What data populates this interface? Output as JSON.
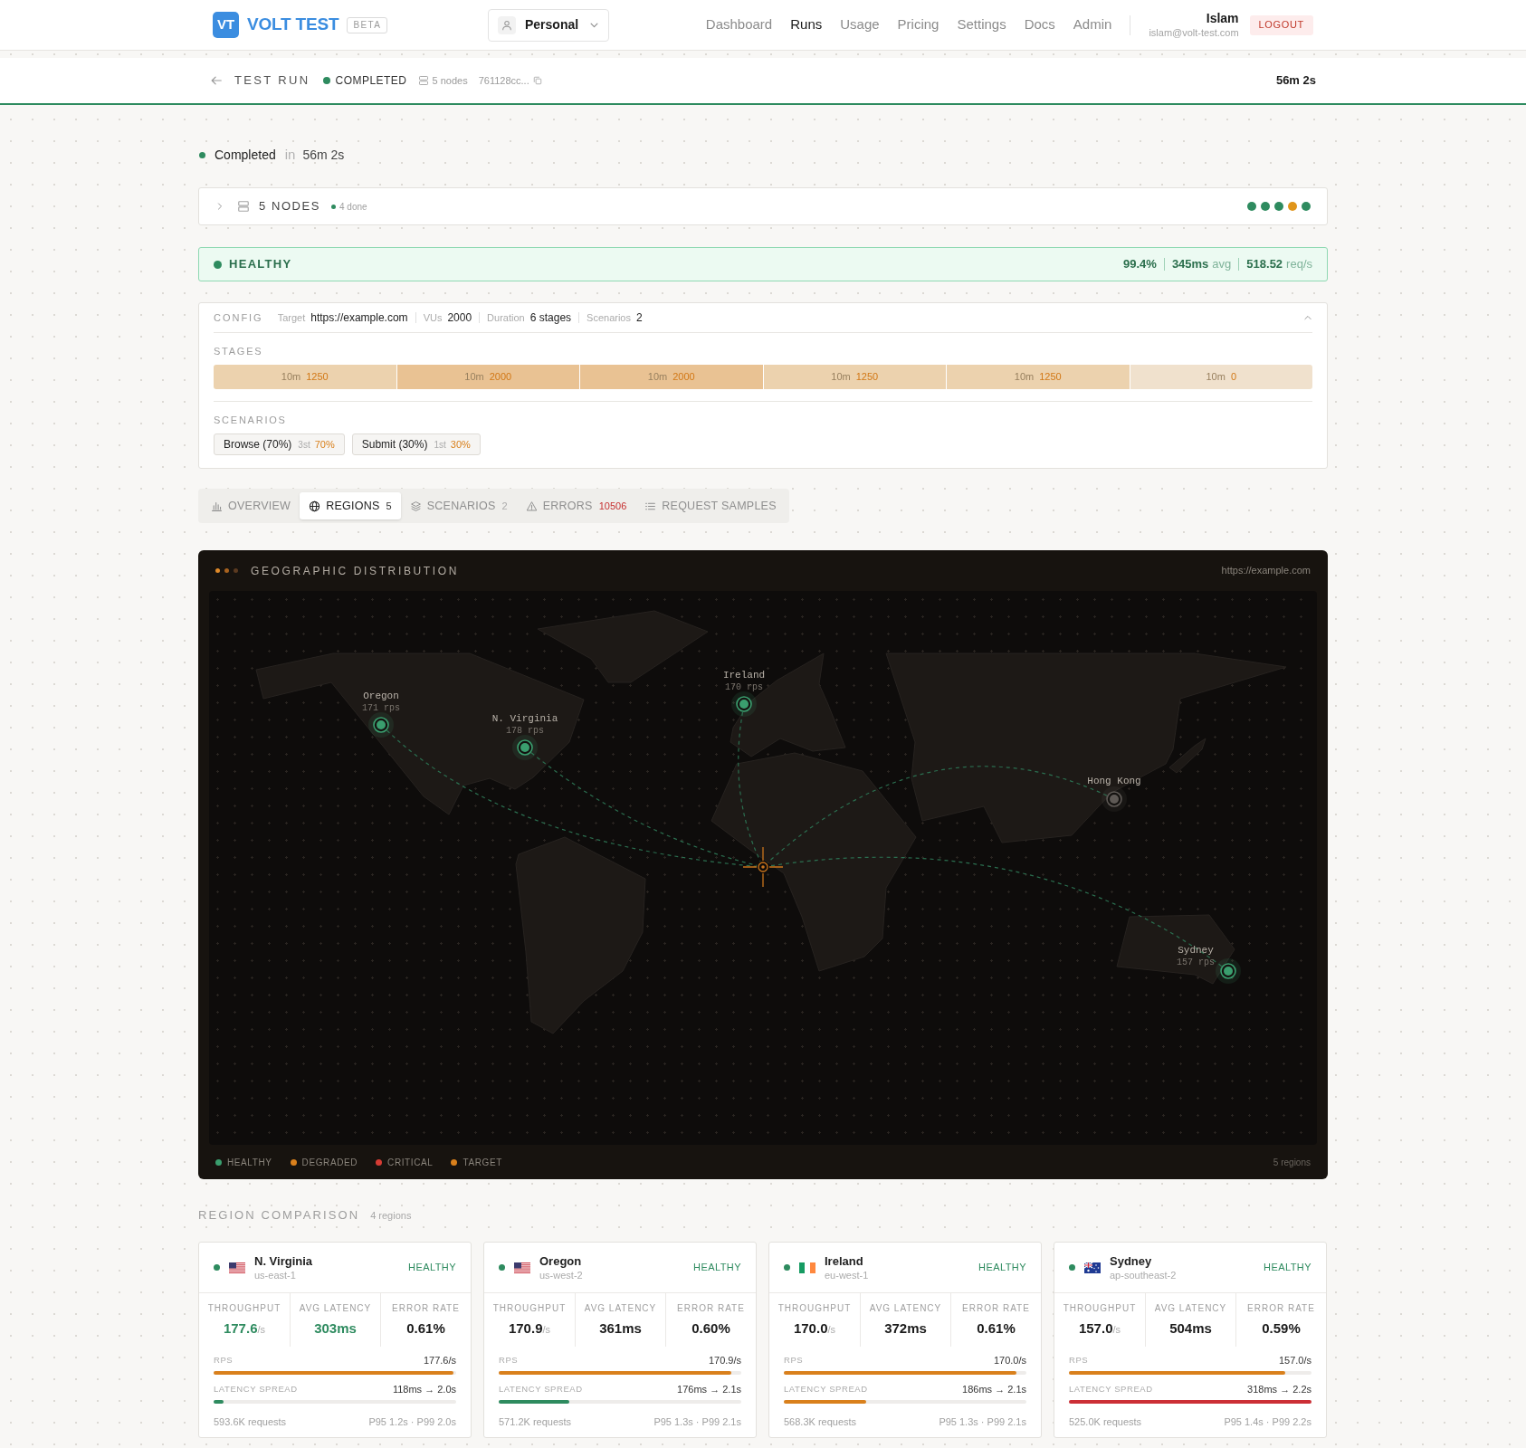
{
  "header": {
    "logo_mark": "VT",
    "brand": "VOLT TEST",
    "badge": "BETA",
    "workspace": "Personal",
    "nav": [
      {
        "label": "Dashboard",
        "selected": false
      },
      {
        "label": "Runs",
        "selected": true
      },
      {
        "label": "Usage",
        "selected": false
      },
      {
        "label": "Pricing",
        "selected": false
      },
      {
        "label": "Settings",
        "selected": false
      },
      {
        "label": "Docs",
        "selected": false
      },
      {
        "label": "Admin",
        "selected": false
      }
    ],
    "user": {
      "name": "Islam",
      "email": "islam@volt-test.com"
    },
    "logout": "LOGOUT"
  },
  "run_bar": {
    "title": "TEST RUN",
    "status": "COMPLETED",
    "nodes": "5 nodes",
    "run_id": "761128cc...",
    "duration": "56m 2s"
  },
  "summary": {
    "status": "Completed",
    "connector": "in",
    "duration": "56m 2s"
  },
  "nodes_panel": {
    "label": "5 NODES",
    "done": "4 done",
    "expanded": false,
    "nodes": [
      {
        "color": "#2e8b5f"
      },
      {
        "color": "#2e8b5f"
      },
      {
        "color": "#2e8b5f"
      },
      {
        "color": "#e0951a"
      },
      {
        "color": "#2e8b5f"
      }
    ]
  },
  "health": {
    "status": "HEALTHY",
    "success_rate": "99.4%",
    "latency": "345ms",
    "latency_unit": "avg",
    "throughput": "518.52",
    "throughput_unit": "req/s"
  },
  "config": {
    "heading": "CONFIG",
    "expanded": true,
    "fields": [
      {
        "label": "Target",
        "value": "https://example.com"
      },
      {
        "label": "VUs",
        "value": "2000"
      },
      {
        "label": "Duration",
        "value": "6 stages"
      },
      {
        "label": "Scenarios",
        "value": "2"
      }
    ],
    "stages_heading": "STAGES",
    "stages": [
      {
        "duration": "10m",
        "target": "1250",
        "color": "#ecd2ae"
      },
      {
        "duration": "10m",
        "target": "2000",
        "color": "#e9c293"
      },
      {
        "duration": "10m",
        "target": "2000",
        "color": "#e9c293"
      },
      {
        "duration": "10m",
        "target": "1250",
        "color": "#ecd2ae"
      },
      {
        "duration": "10m",
        "target": "1250",
        "color": "#ecd2ae"
      },
      {
        "duration": "10m",
        "target": "0",
        "color": "#f0e1cd"
      }
    ],
    "scenarios_heading": "SCENARIOS",
    "scenarios": [
      {
        "name": "Browse (70%)",
        "order": "3st",
        "weight": "70%"
      },
      {
        "name": "Submit (30%)",
        "order": "1st",
        "weight": "30%"
      }
    ]
  },
  "tabs": [
    {
      "kind": "overview",
      "label": "OVERVIEW",
      "selected": false
    },
    {
      "kind": "regions",
      "label": "REGIONS",
      "count": "5",
      "selected": true
    },
    {
      "kind": "scenarios",
      "label": "SCENARIOS",
      "count": "2",
      "selected": false
    },
    {
      "kind": "errors",
      "label": "ERRORS",
      "count": "10506",
      "selected": false
    },
    {
      "kind": "samples",
      "label": "REQUEST SAMPLES",
      "selected": false
    }
  ],
  "map": {
    "title": "GEOGRAPHIC DISTRIBUTION",
    "target": "https://example.com",
    "regions": [
      {
        "name": "Oregon",
        "rps": "171 rps",
        "active": true
      },
      {
        "name": "N. Virginia",
        "rps": "178 rps",
        "active": true
      },
      {
        "name": "Ireland",
        "rps": "170 rps",
        "active": true
      },
      {
        "name": "Hong Kong",
        "active": false
      },
      {
        "name": "Sydney",
        "rps": "157 rps",
        "active": true
      }
    ],
    "legend": [
      {
        "label": "HEALTHY",
        "color": "#3a9e6e"
      },
      {
        "label": "DEGRADED",
        "color": "#d9801c"
      },
      {
        "label": "CRITICAL",
        "color": "#d63c34"
      },
      {
        "label": "TARGET",
        "color": "#d9801c"
      }
    ],
    "region_count": "5 regions"
  },
  "region_comparison": {
    "title": "REGION COMPARISON",
    "count": "4 regions",
    "cards": [
      {
        "kind": "us",
        "name": "N. Virginia",
        "code": "us-east-1",
        "status": "HEALTHY",
        "metrics": [
          {
            "label": "THROUGHPUT",
            "value": "177.6",
            "unit": "/s",
            "best": true
          },
          {
            "label": "AVG LATENCY",
            "value": "303ms",
            "best": true
          },
          {
            "label": "ERROR RATE",
            "value": "0.61%",
            "best": false
          }
        ],
        "rps": {
          "label": "RPS",
          "value": "177.6/s",
          "level": 0.99
        },
        "spread": {
          "label": "LATENCY SPREAD",
          "value": "118ms → 2.0s",
          "level": 0.04,
          "color": "#2e8b5f"
        },
        "requests": "593.6K requests",
        "percentiles": "P95 1.2s · P99 2.0s"
      },
      {
        "kind": "us",
        "name": "Oregon",
        "code": "us-west-2",
        "status": "HEALTHY",
        "metrics": [
          {
            "label": "THROUGHPUT",
            "value": "170.9",
            "unit": "/s",
            "best": false
          },
          {
            "label": "AVG LATENCY",
            "value": "361ms",
            "best": false
          },
          {
            "label": "ERROR RATE",
            "value": "0.60%",
            "best": false
          }
        ],
        "rps": {
          "label": "RPS",
          "value": "170.9/s",
          "level": 0.96
        },
        "spread": {
          "label": "LATENCY SPREAD",
          "value": "176ms → 2.1s",
          "level": 0.29,
          "color": "#2e8b5f"
        },
        "requests": "571.2K requests",
        "percentiles": "P95 1.3s · P99 2.1s"
      },
      {
        "kind": "ie",
        "name": "Ireland",
        "code": "eu-west-1",
        "status": "HEALTHY",
        "metrics": [
          {
            "label": "THROUGHPUT",
            "value": "170.0",
            "unit": "/s",
            "best": false
          },
          {
            "label": "AVG LATENCY",
            "value": "372ms",
            "best": false
          },
          {
            "label": "ERROR RATE",
            "value": "0.61%",
            "best": false
          }
        ],
        "rps": {
          "label": "RPS",
          "value": "170.0/s",
          "level": 0.96
        },
        "spread": {
          "label": "LATENCY SPREAD",
          "value": "186ms → 2.1s",
          "level": 0.34,
          "color": "#d9801c"
        },
        "requests": "568.3K requests",
        "percentiles": "P95 1.3s · P99 2.1s"
      },
      {
        "kind": "au",
        "name": "Sydney",
        "code": "ap-southeast-2",
        "status": "HEALTHY",
        "metrics": [
          {
            "label": "THROUGHPUT",
            "value": "157.0",
            "unit": "/s",
            "best": false
          },
          {
            "label": "AVG LATENCY",
            "value": "504ms",
            "best": false
          },
          {
            "label": "ERROR RATE",
            "value": "0.59%",
            "best": false
          }
        ],
        "rps": {
          "label": "RPS",
          "value": "157.0/s",
          "level": 0.89
        },
        "spread": {
          "label": "LATENCY SPREAD",
          "value": "318ms → 2.2s",
          "level": 1,
          "color": "#cc2f36"
        },
        "requests": "525.0K requests",
        "percentiles": "P95 1.4s · P99 2.2s"
      }
    ]
  }
}
